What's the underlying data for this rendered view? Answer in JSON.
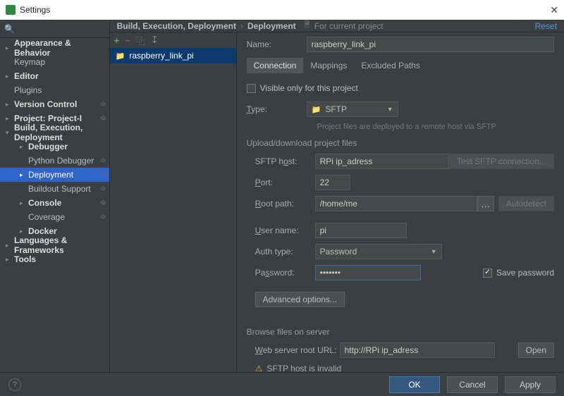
{
  "window": {
    "title": "Settings"
  },
  "crumbs": {
    "a": "Build, Execution, Deployment",
    "b": "Deployment",
    "note": "For current project",
    "reset": "Reset"
  },
  "sidebar": {
    "items": [
      {
        "label": "Appearance & Behavior",
        "arrow": "▸",
        "bold": true
      },
      {
        "label": "Keymap"
      },
      {
        "label": "Editor",
        "arrow": "▸",
        "bold": true
      },
      {
        "label": "Plugins"
      },
      {
        "label": "Version Control",
        "arrow": "▸",
        "bold": true,
        "gear": true
      },
      {
        "label": "Project: Project-I",
        "arrow": "▸",
        "bold": true,
        "gear": true
      },
      {
        "label": "Build, Execution, Deployment",
        "arrow": "▾",
        "bold": true
      },
      {
        "label": "Debugger",
        "arrow": "▸",
        "sub": true,
        "bold": true
      },
      {
        "label": "Python Debugger",
        "sub": true,
        "gear": true
      },
      {
        "label": "Deployment",
        "arrow": "▸",
        "sub": true,
        "selected": true,
        "gear": true
      },
      {
        "label": "Buildout Support",
        "sub": true,
        "gear": true
      },
      {
        "label": "Console",
        "arrow": "▸",
        "sub": true,
        "bold": true,
        "gear": true
      },
      {
        "label": "Coverage",
        "sub": true,
        "gear": true
      },
      {
        "label": "Docker",
        "arrow": "▸",
        "sub": true,
        "bold": true
      },
      {
        "label": "Languages & Frameworks",
        "arrow": "▸",
        "bold": true
      },
      {
        "label": "Tools",
        "arrow": "▸",
        "bold": true
      }
    ]
  },
  "server": {
    "name": "raspberry_link_pi"
  },
  "form": {
    "name_label": "Name:",
    "name_value": "raspberry_link_pi",
    "tabs": {
      "connection": "Connection",
      "mappings": "Mappings",
      "excluded": "Excluded Paths"
    },
    "visible_only": "Visible only for this project",
    "type_label": "Type:",
    "type_value": "SFTP",
    "type_hint": "Project files are deployed to a remote host via SFTP",
    "section_upload": "Upload/download project files",
    "sftp_host_label": "SFTP host:",
    "sftp_host_value": "RPi ip_adress",
    "test_conn": "Test SFTP connection...",
    "port_label": "Port:",
    "port_value": "22",
    "root_label": "Root path:",
    "root_value": "/home/me",
    "autodetect": "Autodetect",
    "user_label": "User name:",
    "user_value": "pi",
    "auth_label": "Auth type:",
    "auth_value": "Password",
    "pwd_label": "Password:",
    "pwd_value": "•••••••",
    "save_pwd": "Save password",
    "advanced": "Advanced options...",
    "section_browse": "Browse files on server",
    "weburl_label": "Web server root URL:",
    "weburl_value": "http://RPi ip_adress",
    "open": "Open",
    "warn": "SFTP host is invalid"
  },
  "footer": {
    "ok": "OK",
    "cancel": "Cancel",
    "apply": "Apply"
  }
}
